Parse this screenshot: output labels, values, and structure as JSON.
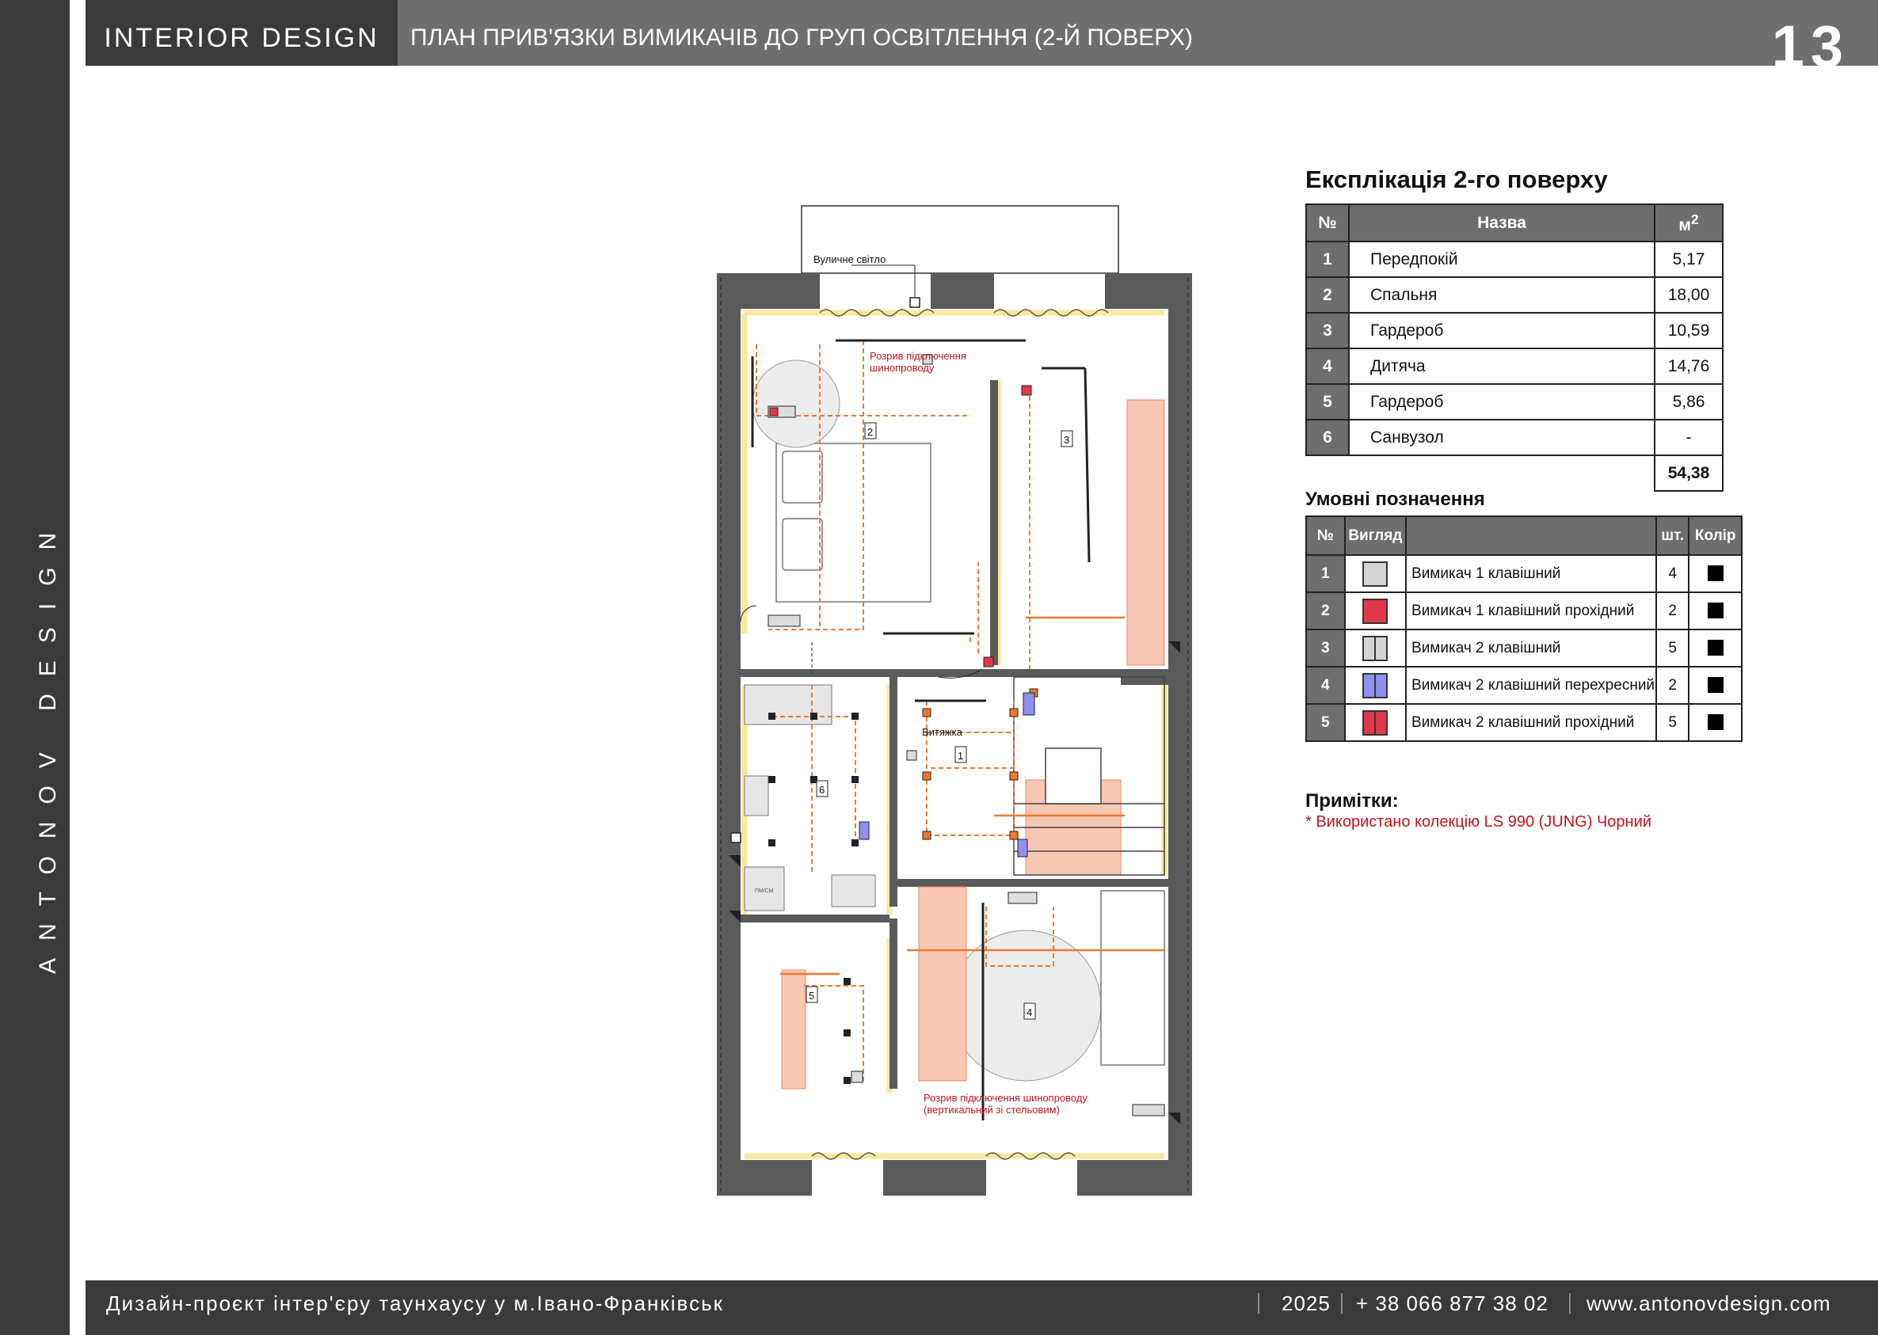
{
  "sidebar": {
    "brand": "ANTONOV DESIGN"
  },
  "header": {
    "brand": "INTERIOR DESIGN",
    "title": "ПЛАН ПРИВ'ЯЗКИ ВИМИКАЧІВ ДО ГРУП ОСВІТЛЕННЯ (2-Й ПОВЕРХ)",
    "page_number": "13"
  },
  "plan": {
    "street_light_label": "Вуличне світло",
    "break_label_top": [
      "Розрив підключення",
      "шинопроводу"
    ],
    "break_label_bottom": [
      "Розрив підключення шинопроводу",
      "(вертикальний зі стельовим)"
    ],
    "hood_label": "Витяжка",
    "appliance_label": "ПМ/СМ",
    "room_numbers": [
      "1",
      "2",
      "3",
      "4",
      "5",
      "6"
    ]
  },
  "explication": {
    "title": "Експлікація 2-го поверху",
    "headers": {
      "num": "№",
      "name": "Назва",
      "area": "м²"
    },
    "rows": [
      {
        "num": "1",
        "name": "Передпокій",
        "area": "5,17"
      },
      {
        "num": "2",
        "name": "Спальня",
        "area": "18,00"
      },
      {
        "num": "3",
        "name": "Гардероб",
        "area": "10,59"
      },
      {
        "num": "4",
        "name": "Дитяча",
        "area": "14,76"
      },
      {
        "num": "5",
        "name": "Гардероб",
        "area": "5,86"
      },
      {
        "num": "6",
        "name": "Санвузол",
        "area": "-"
      }
    ],
    "total": "54,38"
  },
  "legend": {
    "title": "Умовні позначення",
    "headers": {
      "num": "№",
      "view": "Вигляд",
      "name": "",
      "qty": "шт.",
      "color": "Колір"
    },
    "rows": [
      {
        "num": "1",
        "name": "Вимикач 1 клавішний",
        "qty": "4",
        "swatch": "#d4d4d4",
        "split": false
      },
      {
        "num": "2",
        "name": "Вимикач 1 клавішний прохідний",
        "qty": "2",
        "swatch": "#e2384c",
        "split": false
      },
      {
        "num": "3",
        "name": "Вимикач 2 клавішний",
        "qty": "5",
        "swatch": "#d4d4d4",
        "split": true
      },
      {
        "num": "4",
        "name": "Вимикач 2 клавішний перехресний",
        "qty": "2",
        "swatch": "#8f8ff0",
        "split": true
      },
      {
        "num": "5",
        "name": "Вимикач 2 клавішний прохідний",
        "qty": "5",
        "swatch": "#e2384c",
        "split": true
      }
    ]
  },
  "notes": {
    "title": "Примітки:",
    "text": "* Використано колекцію LS 990 (JUNG) Чорний"
  },
  "footer": {
    "project": "Дизайн-проєкт інтер'єру таунхаусу у м.Івано-Франківськ",
    "year": "2025",
    "phone": "+ 38 066 877 38 02",
    "website": "www.antonovdesign.com"
  }
}
